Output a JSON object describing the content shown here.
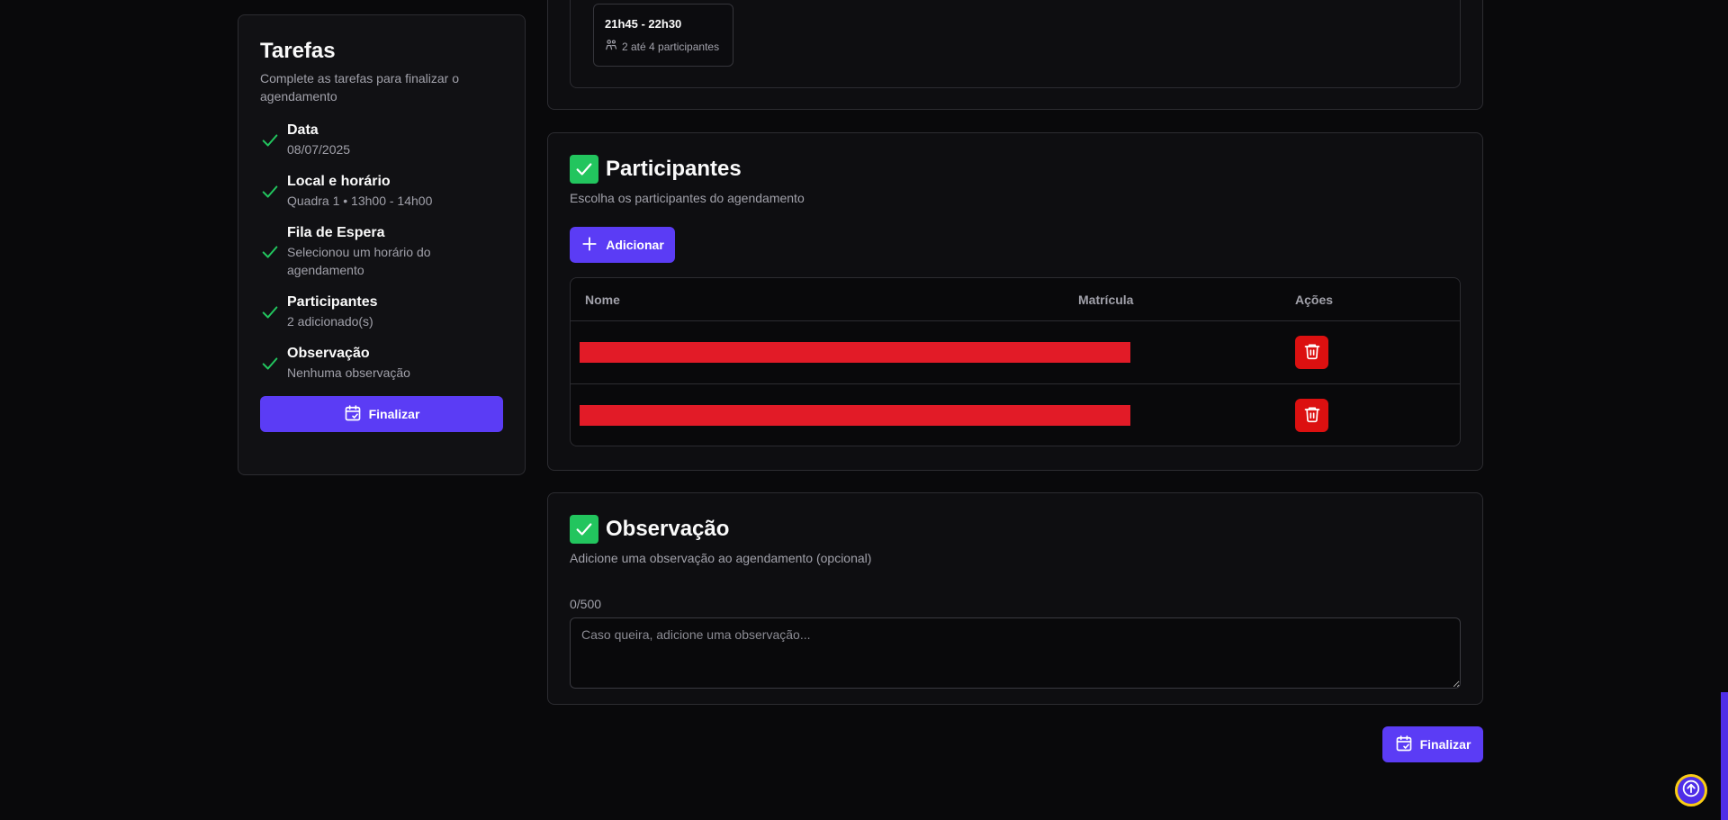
{
  "sidebar": {
    "title": "Tarefas",
    "description": "Complete as tarefas para finalizar o agendamento",
    "tasks": [
      {
        "name": "Data",
        "detail": "08/07/2025"
      },
      {
        "name": "Local e horário",
        "detail": "Quadra 1 • 13h00 - 14h00"
      },
      {
        "name": "Fila de Espera",
        "detail": "Selecionou um horário do agendamento"
      },
      {
        "name": "Participantes",
        "detail": "2 adicionado(s)"
      },
      {
        "name": "Observação",
        "detail": "Nenhuma observação"
      }
    ],
    "finish_label": "Finalizar"
  },
  "timeslot": {
    "time": "21h45 - 22h30",
    "participants": "2 até 4 participantes"
  },
  "participants": {
    "title": "Participantes",
    "description": "Escolha os participantes do agendamento",
    "add_label": "Adicionar",
    "columns": [
      "Nome",
      "Matrícula",
      "Ações"
    ],
    "row_count": 2
  },
  "observation": {
    "title": "Observação",
    "description": "Adicione uma observação ao agendamento (opcional)",
    "counter": "0/500",
    "placeholder": "Caso queira, adicione uma observação...",
    "value": ""
  },
  "footer": {
    "finish_label": "Finalizar"
  },
  "colors": {
    "accent": "#5b3cf5",
    "success": "#22c55e",
    "danger": "#dc1010",
    "redaction": "#e21b27",
    "scroll_ring": "#facc15"
  },
  "icons": {
    "task_done": "check-icon",
    "finish": "calendar-check-icon",
    "people": "users-icon",
    "add": "plus-icon",
    "delete": "trash-icon",
    "scroll_top": "arrow-up-icon"
  }
}
